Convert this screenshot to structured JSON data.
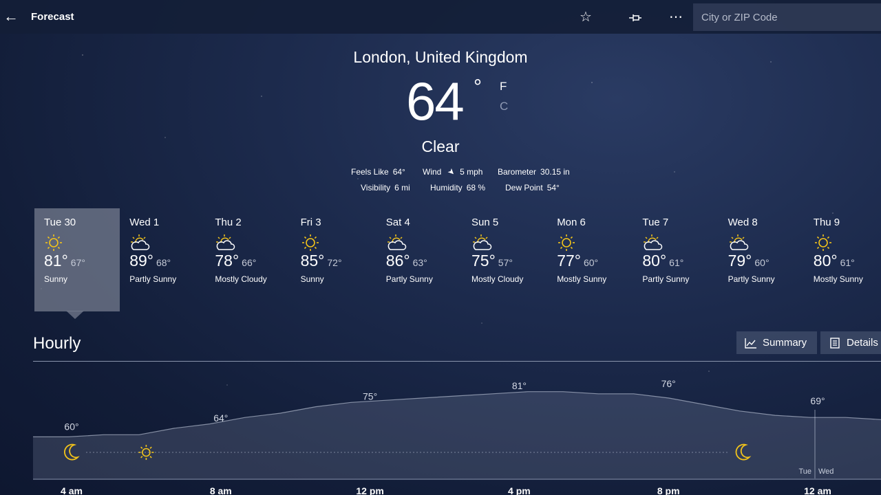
{
  "header": {
    "title": "Forecast",
    "search_placeholder": "City or ZIP Code"
  },
  "current": {
    "location": "London, United Kingdom",
    "temperature": "64",
    "degree": "°",
    "unit_f": "F",
    "unit_c": "C",
    "condition": "Clear",
    "details": [
      {
        "label": "Feels Like",
        "value": "64°"
      },
      {
        "label": "Wind",
        "value": "5 mph"
      },
      {
        "label": "Barometer",
        "value": "30.15 in"
      },
      {
        "label": "Visibility",
        "value": "6 mi"
      },
      {
        "label": "Humidity",
        "value": "68 %"
      },
      {
        "label": "Dew Point",
        "value": "54°"
      }
    ]
  },
  "daily": [
    {
      "day": "Tue 30",
      "hi": "81°",
      "lo": "67°",
      "desc": "Sunny",
      "icon": "sun-icon"
    },
    {
      "day": "Wed 1",
      "hi": "89°",
      "lo": "68°",
      "desc": "Partly Sunny",
      "icon": "partly-sunny-icon"
    },
    {
      "day": "Thu 2",
      "hi": "78°",
      "lo": "66°",
      "desc": "Mostly Cloudy",
      "icon": "partly-sunny-icon"
    },
    {
      "day": "Fri 3",
      "hi": "85°",
      "lo": "72°",
      "desc": "Sunny",
      "icon": "sun-icon"
    },
    {
      "day": "Sat 4",
      "hi": "86°",
      "lo": "63°",
      "desc": "Partly Sunny",
      "icon": "partly-sunny-icon"
    },
    {
      "day": "Sun 5",
      "hi": "75°",
      "lo": "57°",
      "desc": "Mostly Cloudy",
      "icon": "partly-sunny-icon"
    },
    {
      "day": "Mon 6",
      "hi": "77°",
      "lo": "60°",
      "desc": "Mostly Sunny",
      "icon": "sun-icon"
    },
    {
      "day": "Tue 7",
      "hi": "80°",
      "lo": "61°",
      "desc": "Partly Sunny",
      "icon": "partly-sunny-icon"
    },
    {
      "day": "Wed 8",
      "hi": "79°",
      "lo": "60°",
      "desc": "Partly Sunny",
      "icon": "partly-sunny-icon"
    },
    {
      "day": "Thu 9",
      "hi": "80°",
      "lo": "61°",
      "desc": "Mostly Sunny",
      "icon": "sun-icon"
    }
  ],
  "hourly": {
    "title": "Hourly",
    "summary_label": "Summary",
    "details_label": "Details",
    "divider_labels": [
      "Tue",
      "Wed"
    ]
  },
  "colors": {
    "icon_yellow": "#f3c41a",
    "selected_day_bg": "#787f91"
  },
  "chart_data": {
    "type": "area",
    "x": [
      "4 am",
      "8 am",
      "12 pm",
      "4 pm",
      "8 pm",
      "12 am"
    ],
    "temperature_labels": [
      {
        "x": "4 am",
        "label": "60°",
        "value": 60
      },
      {
        "x": "8 am",
        "label": "64°",
        "value": 64
      },
      {
        "x": "12 pm",
        "label": "75°",
        "value": 75
      },
      {
        "x": "4 pm",
        "label": "81°",
        "value": 81
      },
      {
        "x": "8 pm",
        "label": "76°",
        "value": 76
      },
      {
        "x": "12 am",
        "label": "69°",
        "value": 69
      }
    ],
    "series": [
      {
        "values": [
          60,
          60,
          61,
          61,
          64,
          66,
          69,
          71,
          74,
          76,
          77,
          78,
          79,
          80,
          81,
          81,
          80,
          80,
          78,
          75,
          72,
          70,
          69,
          69,
          68
        ]
      }
    ],
    "condition_icons": [
      {
        "x": "4 am",
        "icon": "moon-icon"
      },
      {
        "x": "6 am",
        "icon": "sun-icon"
      },
      {
        "x": "10 pm",
        "icon": "moon-icon"
      }
    ]
  }
}
